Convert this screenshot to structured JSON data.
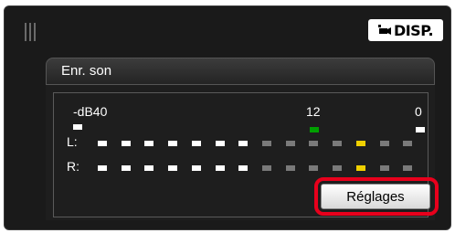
{
  "header": {
    "disp_label": "DISP.",
    "disp_icon": "movie-camera-icon"
  },
  "panel": {
    "title": "Enr. son"
  },
  "meter": {
    "db_label": "-dB40",
    "tick_mid": "12",
    "tick_end": "0",
    "left_label": "L:",
    "right_label": "R:",
    "segment_count": 14,
    "left_level_segments": 7,
    "right_level_segments": 7,
    "peak_hold_segment": 11,
    "colors": {
      "lit": "#ffffff",
      "unlit": "#7a7a7a",
      "peak": "#f0d000",
      "green_marker": "#00a000"
    }
  },
  "actions": {
    "settings_label": "Réglages"
  }
}
